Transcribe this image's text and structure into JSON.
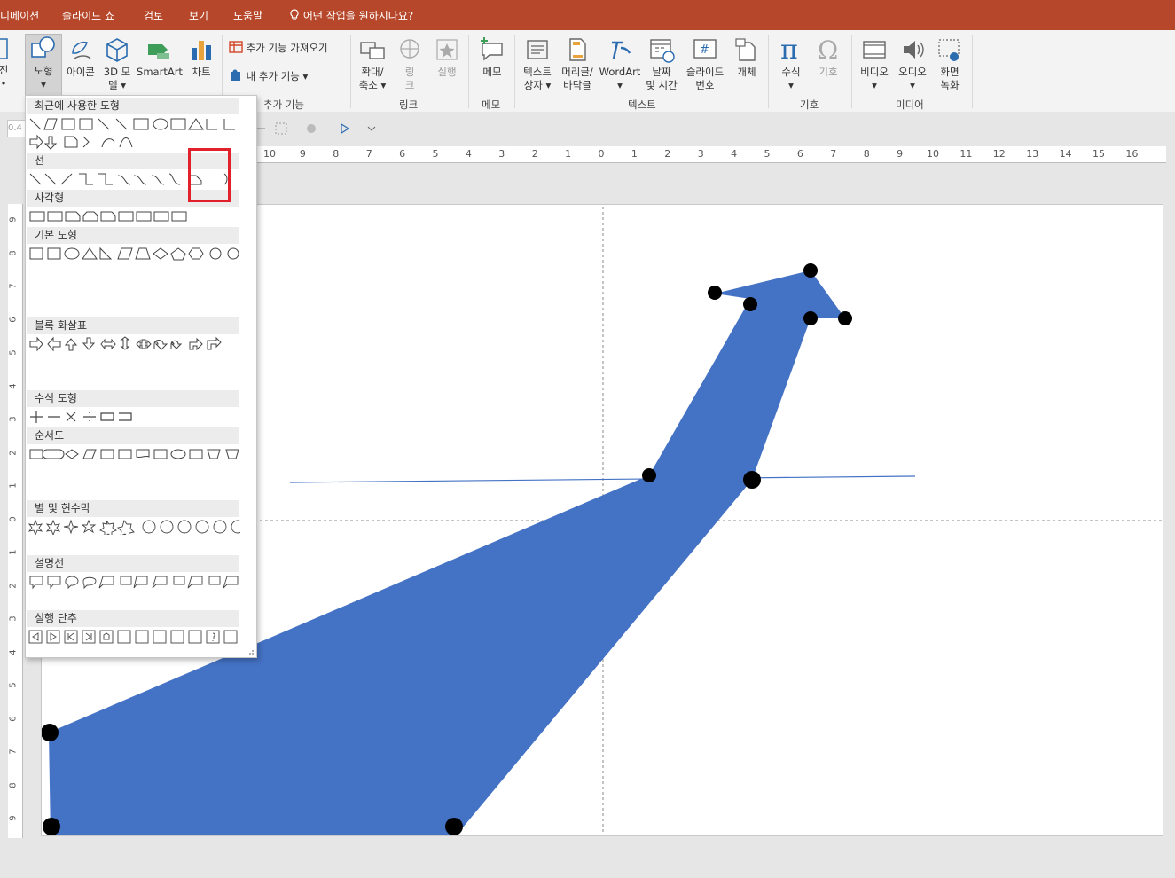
{
  "tabs": [
    "니메이션",
    "슬라이드 쇼",
    "검토",
    "보기",
    "도움말"
  ],
  "tell_me": "어떤 작업을 원하시나요?",
  "ribbon": {
    "buttons": [
      {
        "label": "진",
        "sub": "•",
        "icon": "cut-off-icon"
      },
      {
        "label": "도형",
        "sub": "▾",
        "icon": "shapes-icon"
      },
      {
        "label": "아이콘",
        "icon": "icons-icon"
      },
      {
        "label": "3D 모",
        "sub": "델 ▾",
        "icon": "3d-models-icon"
      },
      {
        "label": "SmartArt",
        "icon": "smartart-icon"
      },
      {
        "label": "차트",
        "icon": "chart-icon"
      }
    ],
    "addins": {
      "get_addins": "추가 기능 가져오기",
      "my_addins": "내 추가 기능",
      "group": "추가 기능"
    },
    "links": {
      "zoom": "확대/",
      "zoom2": "축소 ▾",
      "link": "링",
      "link2": "크",
      "action": "실행",
      "group": "링크"
    },
    "comments": {
      "comment": "메모",
      "group": "메모"
    },
    "text": {
      "textbox": "텍스트",
      "textbox2": "상자 ▾",
      "header": "머리글/",
      "header2": "바닥글",
      "wordart": "WordArt",
      "wordart2": "▾",
      "datetime": "날짜",
      "datetime2": "및 시간",
      "slidenum": "슬라이드",
      "slidenum2": "번호",
      "object": "개체",
      "group": "텍스트"
    },
    "symbols": {
      "equation": "수식",
      "equation2": "▾",
      "symbol": "기호",
      "group": "기호"
    },
    "media": {
      "video": "비디오",
      "video2": "▾",
      "audio": "오디오",
      "audio2": "▾",
      "screenrec": "화면",
      "screenrec2": "녹화",
      "group": "미디어"
    }
  },
  "format_box": "0.4",
  "ruler": {
    "h": [
      "10",
      "9",
      "8",
      "7",
      "6",
      "5",
      "4",
      "3",
      "2",
      "1",
      "0",
      "1",
      "2",
      "3",
      "4",
      "5",
      "6",
      "7",
      "8",
      "9",
      "10",
      "11",
      "12",
      "13",
      "14",
      "15",
      "16"
    ],
    "v": [
      "9",
      "8",
      "7",
      "6",
      "5",
      "4",
      "3",
      "2",
      "1",
      "0",
      "1",
      "2",
      "3",
      "4",
      "5",
      "6",
      "7",
      "8",
      "9"
    ]
  },
  "gallery": {
    "categories": [
      "최근에 사용한 도형",
      "선",
      "사각형",
      "기본 도형",
      "블록 화살표",
      "수식 도형",
      "순서도",
      "별 및 현수막",
      "설명선",
      "실행 단추"
    ]
  },
  "colors": {
    "tabbar": "#b7472a",
    "shape_fill": "#4472c4",
    "highlight": "#e0202a",
    "points": "#000000"
  }
}
